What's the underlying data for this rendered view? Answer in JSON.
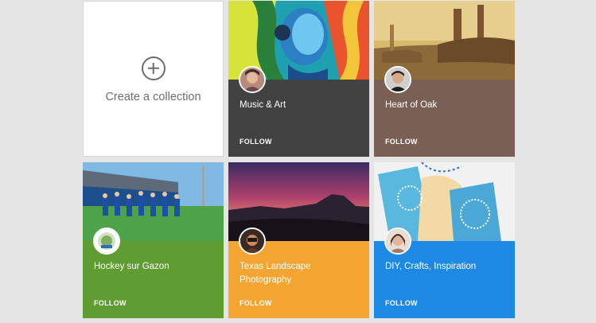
{
  "create": {
    "label": "Create a collection"
  },
  "collections": [
    {
      "title": "Music & Art",
      "follow_label": "FOLLOW",
      "color": "#424242"
    },
    {
      "title": "Heart of Oak",
      "follow_label": "FOLLOW",
      "color": "#795f54"
    },
    {
      "title": "Hockey sur Gazon",
      "follow_label": "FOLLOW",
      "color": "#5f9c32"
    },
    {
      "title": "Texas Landscape Photography",
      "follow_label": "FOLLOW",
      "color": "#f4a430"
    },
    {
      "title": "DIY, Crafts, Inspiration",
      "follow_label": "FOLLOW",
      "color": "#1e88e5"
    }
  ]
}
